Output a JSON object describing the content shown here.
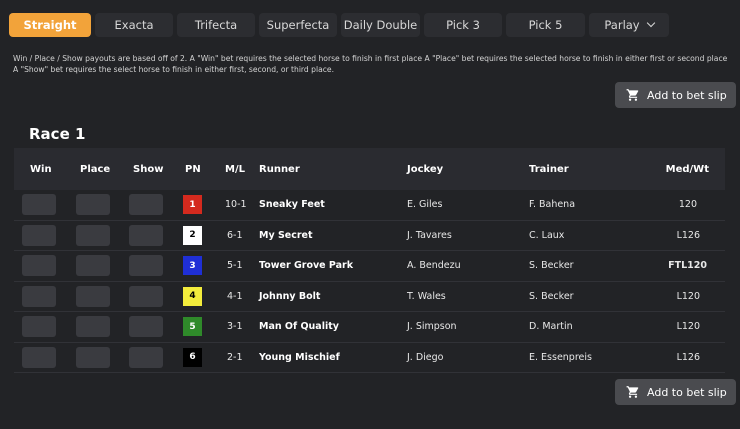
{
  "tabs": [
    {
      "label": "Straight",
      "active": true
    },
    {
      "label": "Exacta"
    },
    {
      "label": "Trifecta"
    },
    {
      "label": "Superfecta"
    },
    {
      "label": "Daily Double"
    },
    {
      "label": "Pick 3"
    },
    {
      "label": "Pick 5"
    },
    {
      "label": "Parlay"
    }
  ],
  "description": "Win / Place / Show payouts are based off of 2. A \"Win\" bet requires the selected horse to finish in first place A \"Place\" bet requires the selected horse to finish in either first or second place A \"Show\" bet requires the select horse to finish in either first, second, or third place.",
  "bet_slip_label": "Add to bet slip",
  "race_title": "Race 1",
  "columns": {
    "win": "Win",
    "place": "Place",
    "show": "Show",
    "pn": "PN",
    "ml": "M/L",
    "runner": "Runner",
    "jockey": "Jockey",
    "trainer": "Trainer",
    "medwt": "Med/Wt"
  },
  "rows": [
    {
      "pn": "1",
      "pn_bg": "#d42a1e",
      "pn_fg": "#ffffff",
      "ml": "10-1",
      "runner": "Sneaky Feet",
      "jockey": "E. Giles",
      "trainer": "F. Bahena",
      "medwt": "120"
    },
    {
      "pn": "2",
      "pn_bg": "#ffffff",
      "pn_fg": "#000000",
      "ml": "6-1",
      "runner": "My Secret",
      "jockey": "J. Tavares",
      "trainer": "C. Laux",
      "medwt": "L126"
    },
    {
      "pn": "3",
      "pn_bg": "#1f2fd6",
      "pn_fg": "#ffffff",
      "ml": "5-1",
      "runner": "Tower Grove Park",
      "jockey": "A. Bendezu",
      "trainer": "S. Becker",
      "medwt": "FTL120"
    },
    {
      "pn": "4",
      "pn_bg": "#f3ec3c",
      "pn_fg": "#000000",
      "ml": "4-1",
      "runner": "Johnny Bolt",
      "jockey": "T. Wales",
      "trainer": "S. Becker",
      "medwt": "L120"
    },
    {
      "pn": "5",
      "pn_bg": "#2f8a2a",
      "pn_fg": "#ffffff",
      "ml": "3-1",
      "runner": "Man Of Quality",
      "jockey": "J. Simpson",
      "trainer": "D. Martin",
      "medwt": "L120"
    },
    {
      "pn": "6",
      "pn_bg": "#000000",
      "pn_fg": "#ffffff",
      "ml": "2-1",
      "runner": "Young Mischief",
      "jockey": "J. Diego",
      "trainer": "E. Essenpreis",
      "medwt": "L126"
    }
  ]
}
